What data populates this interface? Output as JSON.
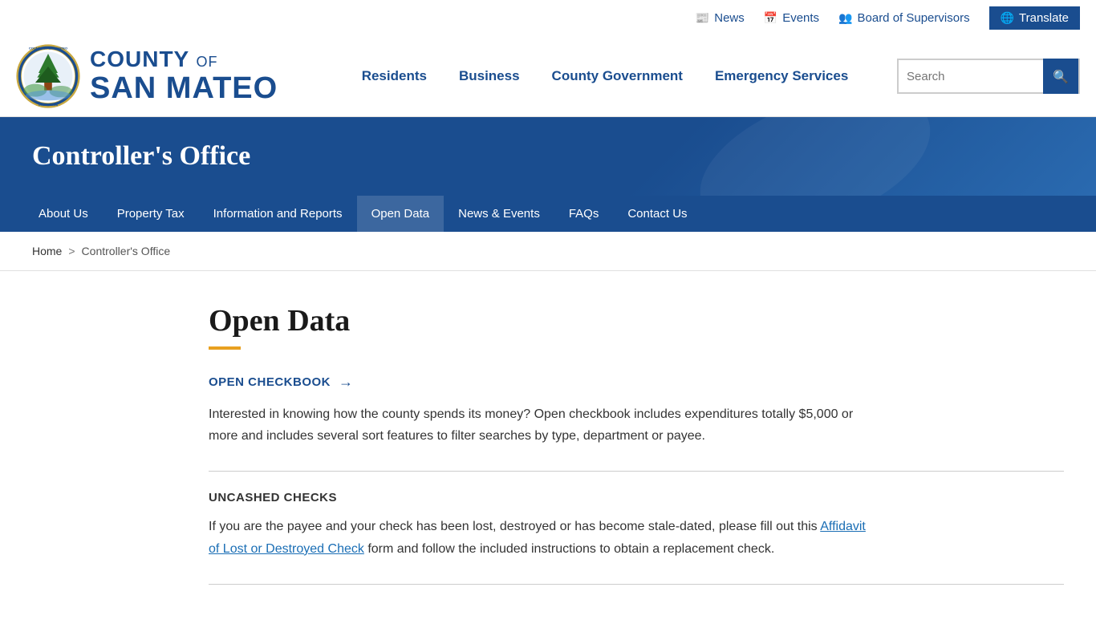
{
  "topbar": {
    "news_label": "News",
    "events_label": "Events",
    "board_label": "Board of Supervisors",
    "translate_label": "Translate"
  },
  "header": {
    "logo_county_line1_prefix": "COUNTY",
    "logo_county_line1_suffix": "OF",
    "logo_san_mateo": "SAN MATEO",
    "logo_state": "CALIFORNIA"
  },
  "main_nav": {
    "residents": "Residents",
    "business": "Business",
    "county_government": "County Government",
    "emergency_services": "Emergency Services"
  },
  "search": {
    "placeholder": "Search"
  },
  "section_header": {
    "title": "Controller's Office"
  },
  "sub_nav": {
    "items": [
      {
        "label": "About Us",
        "active": false
      },
      {
        "label": "Property Tax",
        "active": false
      },
      {
        "label": "Information and Reports",
        "active": false
      },
      {
        "label": "Open Data",
        "active": true
      },
      {
        "label": "News & Events",
        "active": false
      },
      {
        "label": "FAQs",
        "active": false
      },
      {
        "label": "Contact Us",
        "active": false
      }
    ]
  },
  "breadcrumb": {
    "home": "Home",
    "separator": ">",
    "current": "Controller's Office"
  },
  "content": {
    "page_title": "Open Data",
    "open_checkbook": {
      "label": "OPEN CHECKBOOK",
      "arrow": "→",
      "description": "Interested in knowing how the county spends its money? Open checkbook includes expenditures totally $5,000 or more and includes several sort features to filter searches by type, department or payee."
    },
    "uncashed_checks": {
      "title": "UNCASHED CHECKS",
      "text_before": "If you are the payee and your check has been lost, destroyed or has become stale-dated, please fill out this ",
      "link_text": "Affidavit of Lost or Destroyed Check",
      "text_after": " form and follow the included instructions to obtain a replacement check."
    }
  }
}
